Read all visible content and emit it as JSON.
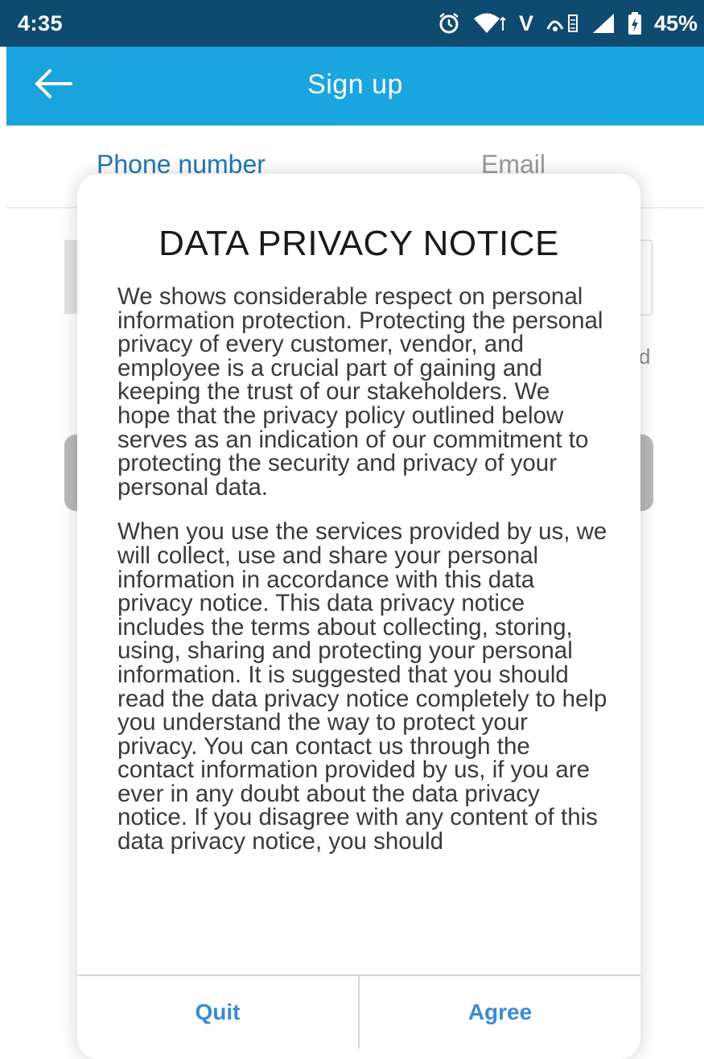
{
  "status_bar": {
    "time": "4:35",
    "network_label": "V",
    "battery_percent": "45%"
  },
  "app_bar": {
    "title": "Sign up"
  },
  "tabs": [
    {
      "label": "Phone number",
      "active": true
    },
    {
      "label": "Email",
      "active": false
    }
  ],
  "background": {
    "hint_fragment": "d"
  },
  "dialog": {
    "title": "DATA PRIVACY NOTICE",
    "paragraphs": [
      "We shows considerable respect on personal information protection. Protecting the personal privacy of every customer, vendor, and employee is a crucial part of gaining and keeping the trust of our stakeholders. We hope that the privacy policy outlined below serves as an indication of our commitment to protecting the security and privacy of your personal data.",
      "When you use the services provided by us, we will collect, use and share your personal information in accordance with this data privacy notice. This data privacy notice includes the terms about collecting, storing, using, sharing and protecting your personal information. It is suggested that you should read the data privacy notice completely to help you understand the way to protect your privacy. You can contact us through the contact information provided by us, if you are ever in any doubt about the data privacy notice. If you disagree with any content of this data privacy notice, you should"
    ],
    "quit_label": "Quit",
    "agree_label": "Agree"
  },
  "colors": {
    "status_bar": "#0f4a70",
    "app_bar": "#1aa3dc",
    "active_tab": "#1e78b9",
    "action_text": "#3a8ad6"
  }
}
